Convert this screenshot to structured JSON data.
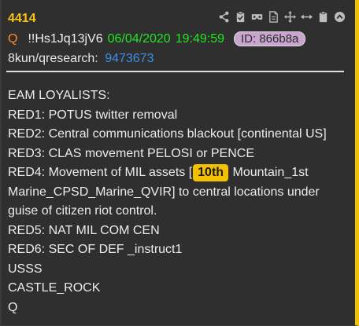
{
  "post": {
    "number": "4414",
    "q_mark": "Q",
    "tripcode": "!!Hs1Jq13jV6",
    "date": "06/04/2020",
    "time": "19:49:59",
    "id_badge": "ID: 866b8a",
    "board": "8kun/qresearch:",
    "thread_link": "9473673"
  },
  "toolbar": {
    "icons": [
      "share-icon",
      "clipboard-check-icon",
      "vr-headset-icon",
      "document-icon",
      "move-icon",
      "expand-horizontal-icon",
      "clipboard-icon",
      "collapse-up-icon"
    ]
  },
  "message": {
    "line1": "EAM LOYALISTS:",
    "line2": "RED1: POTUS twitter removal",
    "line3": "RED2: Central communications blackout [continental US]",
    "line4": "RED3: CLAS movement PELOSI or PENCE",
    "line5_before": "RED4: Movement of MIL assets [",
    "line5_highlight": "10th",
    "line5_after": " Mountain_1st Marine_CPSD_Marine_QVIR] to central locations under guise of citizen riot control.",
    "line6": "RED5: NAT MIL COM CEN",
    "line7": "RED6: SEC OF DEF _instruct1",
    "line8": "USSS",
    "line9": "CASTLE_ROCK",
    "line10": "Q"
  },
  "colors": {
    "post_number": "#f5c518",
    "accent_bar": "#f2c200",
    "date_time": "#21e621",
    "q_mark": "#ff8a2a",
    "link": "#3b8fe6",
    "id_badge_bg": "#c9a5cf"
  }
}
